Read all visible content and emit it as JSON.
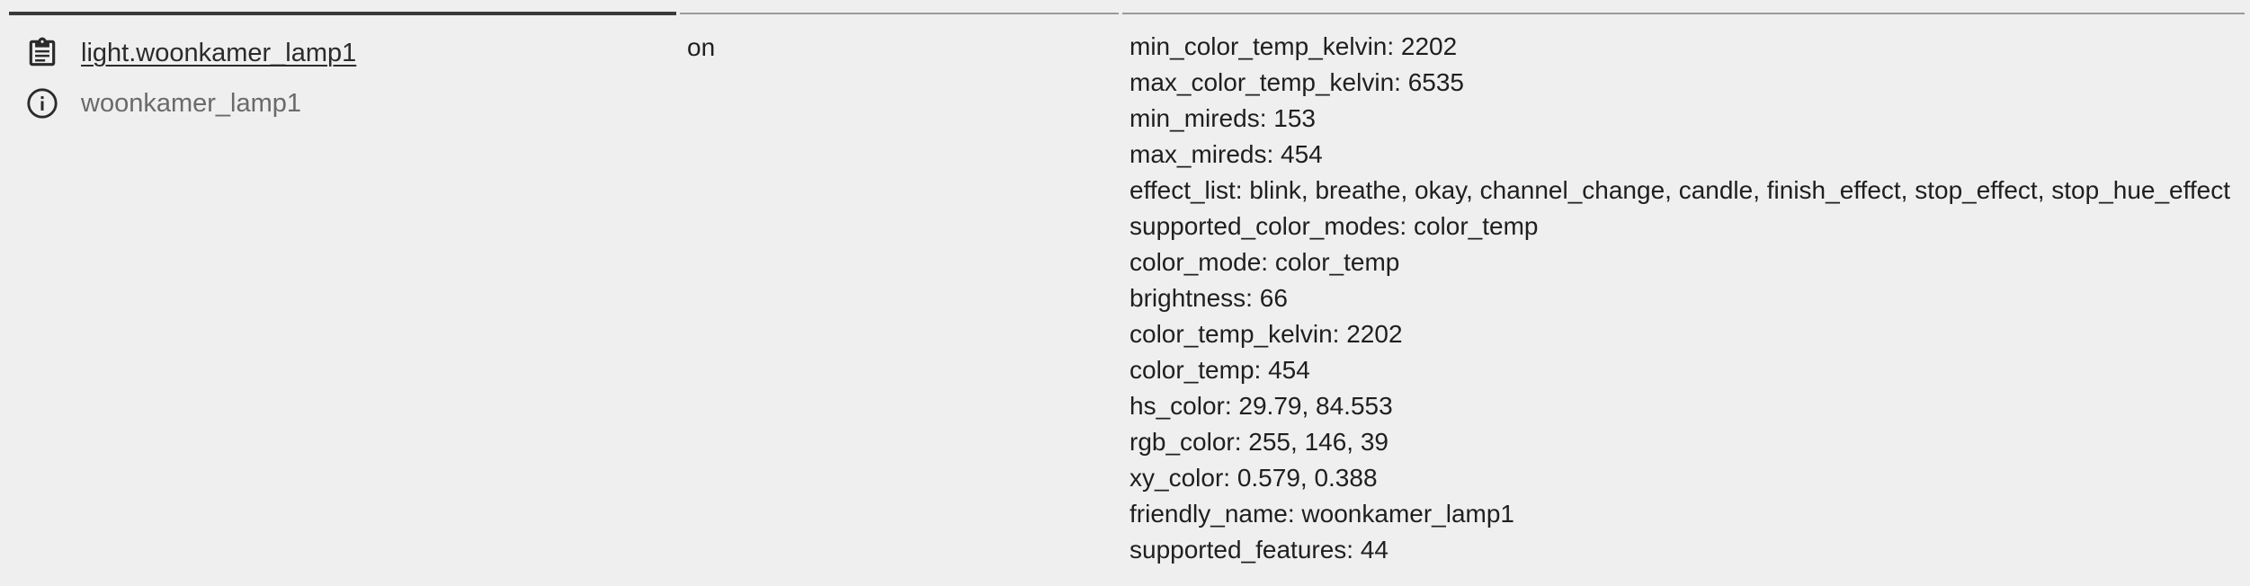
{
  "entity": {
    "entity_id": "light.woonkamer_lamp1",
    "friendly_name": "woonkamer_lamp1",
    "copy_icon": "clipboard-icon",
    "info_icon": "info-icon"
  },
  "state": {
    "value": "on"
  },
  "attributes": [
    "min_color_temp_kelvin: 2202",
    "max_color_temp_kelvin: 6535",
    "min_mireds: 153",
    "max_mireds: 454",
    "effect_list: blink, breathe, okay, channel_change, candle, finish_effect, stop_effect, stop_hue_effect",
    "supported_color_modes: color_temp",
    "color_mode: color_temp",
    "brightness: 66",
    "color_temp_kelvin: 2202",
    "color_temp: 454",
    "hs_color: 29.79, 84.553",
    "rgb_color: 255, 146, 39",
    "xy_color: 0.579, 0.388",
    "friendly_name: woonkamer_lamp1",
    "supported_features: 44"
  ],
  "colors": {
    "background": "#efefef",
    "text": "#1f1f1f",
    "muted_text": "#6a6a6a",
    "divider": "#9a9a9a"
  }
}
